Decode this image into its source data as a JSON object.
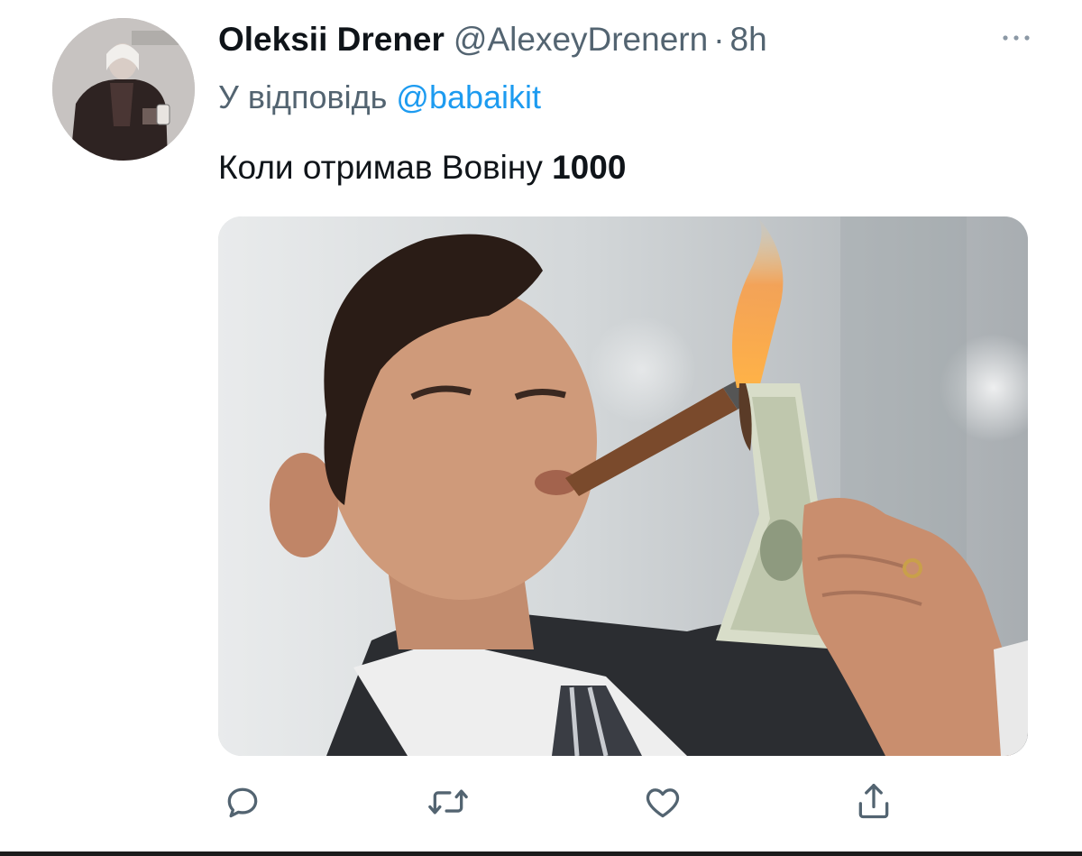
{
  "tweet": {
    "author": {
      "display_name": "Oleksii Drener",
      "handle": "@AlexeyDrenern",
      "separator": "·",
      "time": "8h",
      "avatar_icon": "avatar-person-icon"
    },
    "reply_prefix": "У відповідь",
    "reply_to": "@babaikit",
    "text_main": "Коли отримав Вовіну ",
    "text_bold": "1000",
    "more_icon": "more-dots-icon",
    "media_description_icon": "photo-man-cigar-burning-dollar",
    "actions": [
      {
        "name": "reply",
        "icon": "reply-icon"
      },
      {
        "name": "retweet",
        "icon": "retweet-icon"
      },
      {
        "name": "like",
        "icon": "like-icon"
      },
      {
        "name": "share",
        "icon": "share-icon"
      }
    ]
  },
  "colors": {
    "text_primary": "#0f1419",
    "text_secondary": "#536471",
    "accent": "#1d9bf0"
  }
}
